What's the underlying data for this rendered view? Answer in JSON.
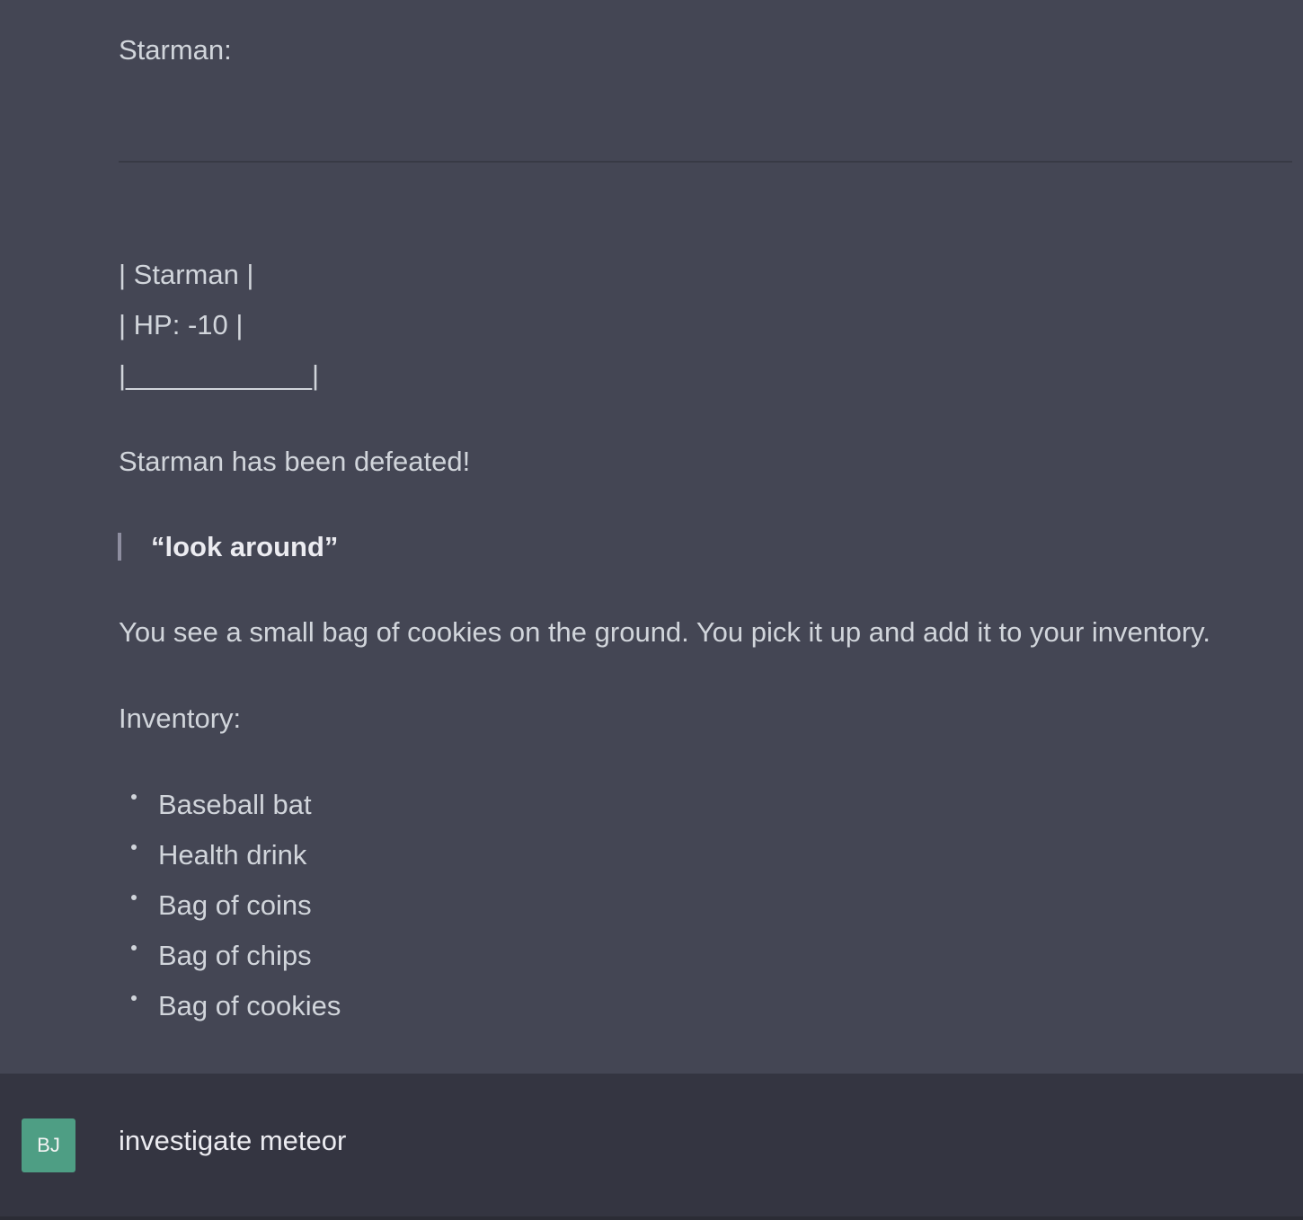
{
  "assistant": {
    "speaker_line": "Starman:",
    "box_lines": [
      "| Starman |",
      "| HP: -10 |",
      "|____________|"
    ],
    "defeat_text": "Starman has been defeated!",
    "quote": "“look around”",
    "description": "You see a small bag of cookies on the ground. You pick it up and add it to your inventory.",
    "inventory_heading": "Inventory:",
    "inventory_items": [
      "Baseball bat",
      "Health drink",
      "Bag of coins",
      "Bag of chips",
      "Bag of cookies"
    ]
  },
  "user": {
    "avatar_initials": "BJ",
    "avatar_color": "#4e9e84",
    "message": "investigate meteor"
  }
}
